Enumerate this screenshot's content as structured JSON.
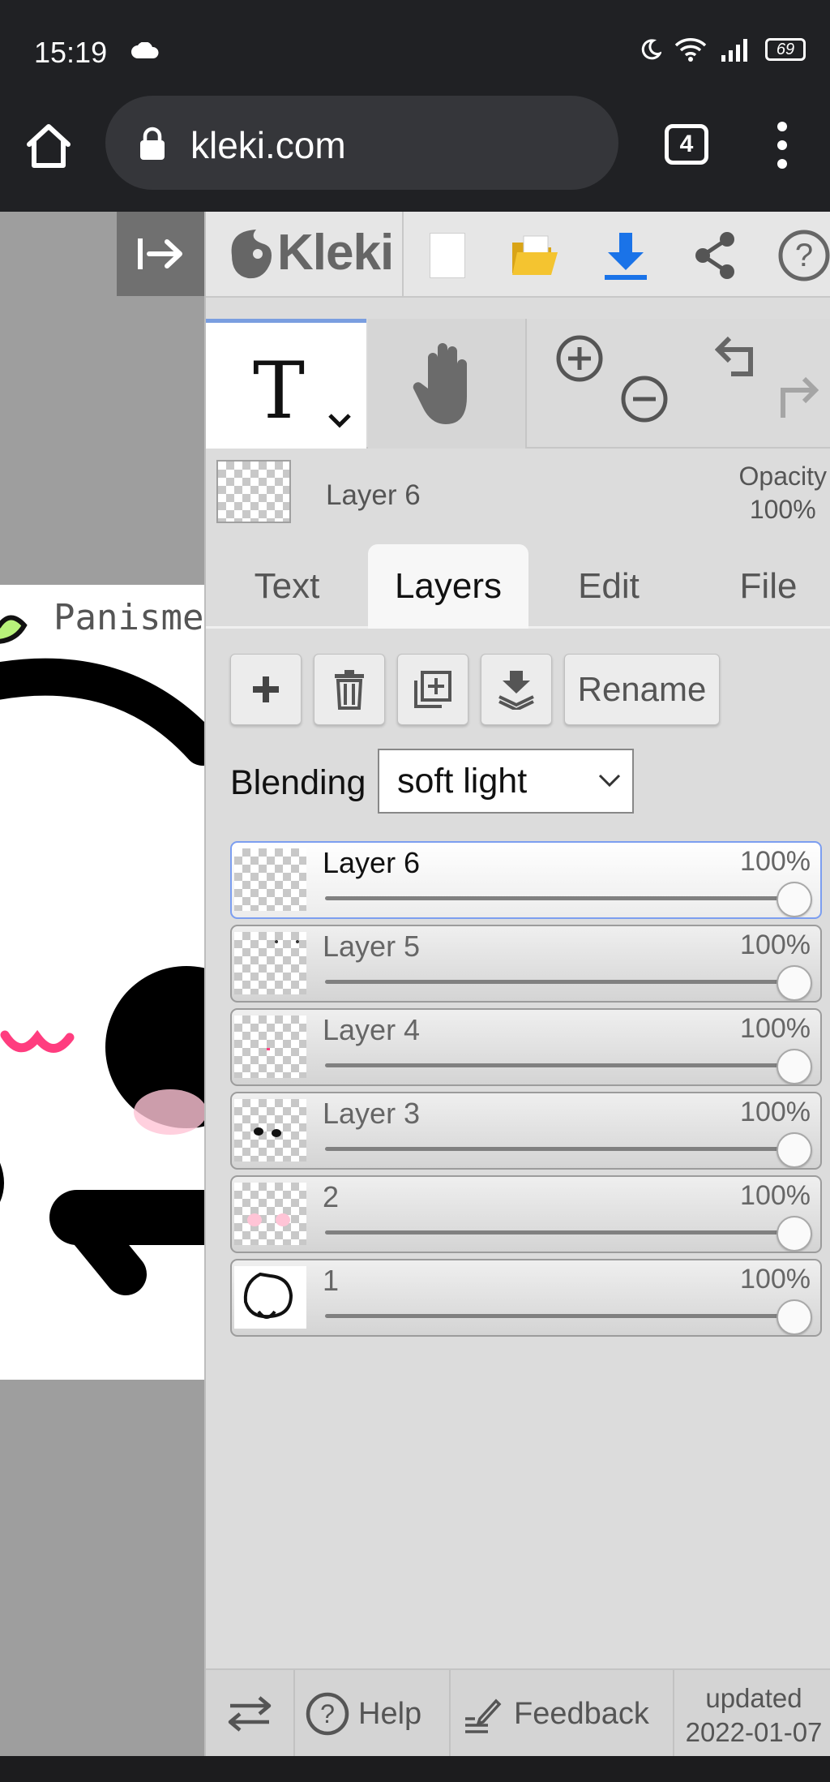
{
  "status_bar": {
    "time": "15:19",
    "battery": "69"
  },
  "browser": {
    "url": "kleki.com",
    "tab_count": "4"
  },
  "canvas": {
    "caption": "Panisme"
  },
  "app": {
    "logo_text": "Kleki",
    "current_layer": {
      "name": "Layer 6",
      "opacity_label": "Opacity",
      "opacity_value": "100%"
    },
    "tabs": [
      "Text",
      "Layers",
      "Edit",
      "File"
    ],
    "active_tab": "Layers",
    "actions": {
      "rename_label": "Rename"
    },
    "blending": {
      "label": "Blending",
      "value": "soft light"
    },
    "layers": [
      {
        "name": "Layer 6",
        "opacity": "100%",
        "selected": true
      },
      {
        "name": "Layer 5",
        "opacity": "100%",
        "selected": false
      },
      {
        "name": "Layer 4",
        "opacity": "100%",
        "selected": false
      },
      {
        "name": "Layer 3",
        "opacity": "100%",
        "selected": false
      },
      {
        "name": "2",
        "opacity": "100%",
        "selected": false
      },
      {
        "name": "1",
        "opacity": "100%",
        "selected": false
      }
    ],
    "footer": {
      "help_label": "Help",
      "feedback_label": "Feedback",
      "updated_label": "updated",
      "updated_date": "2022-01-07"
    }
  },
  "colors": {
    "accent_blue": "#1a73e8",
    "folder_yellow": "#f4c430",
    "selected_border": "#7c9ef0",
    "blush_pink": "#ff3d7f"
  }
}
